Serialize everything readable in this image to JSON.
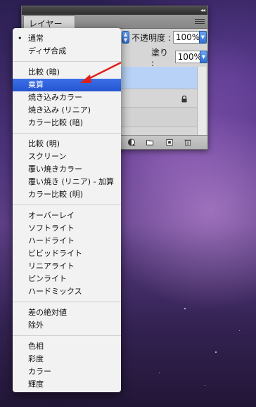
{
  "panel": {
    "tab_label": "レイヤー",
    "opacity_label": "不透明度 :",
    "opacity_value": "100%",
    "fill_label": "塗り :",
    "fill_value": "100%"
  },
  "menu": {
    "groups": [
      [
        {
          "label": "通常",
          "checked": true
        },
        {
          "label": "ディザ合成"
        }
      ],
      [
        {
          "label": "比較 (暗)"
        },
        {
          "label": "乗算",
          "highlighted": true
        },
        {
          "label": "焼き込みカラー"
        },
        {
          "label": "焼き込み (リニア)"
        },
        {
          "label": "カラー比較 (暗)"
        }
      ],
      [
        {
          "label": "比較 (明)"
        },
        {
          "label": "スクリーン"
        },
        {
          "label": "覆い焼きカラー"
        },
        {
          "label": "覆い焼き (リニア) - 加算"
        },
        {
          "label": "カラー比較 (明)"
        }
      ],
      [
        {
          "label": "オーバーレイ"
        },
        {
          "label": "ソフトライト"
        },
        {
          "label": "ハードライト"
        },
        {
          "label": "ビビッドライト"
        },
        {
          "label": "リニアライト"
        },
        {
          "label": "ピンライト"
        },
        {
          "label": "ハードミックス"
        }
      ],
      [
        {
          "label": "差の絶対値"
        },
        {
          "label": "除外"
        }
      ],
      [
        {
          "label": "色相"
        },
        {
          "label": "彩度"
        },
        {
          "label": "カラー"
        },
        {
          "label": "輝度"
        }
      ]
    ]
  },
  "colors": {
    "highlight": "#2b5fdc",
    "arrow": "#e0201a"
  }
}
